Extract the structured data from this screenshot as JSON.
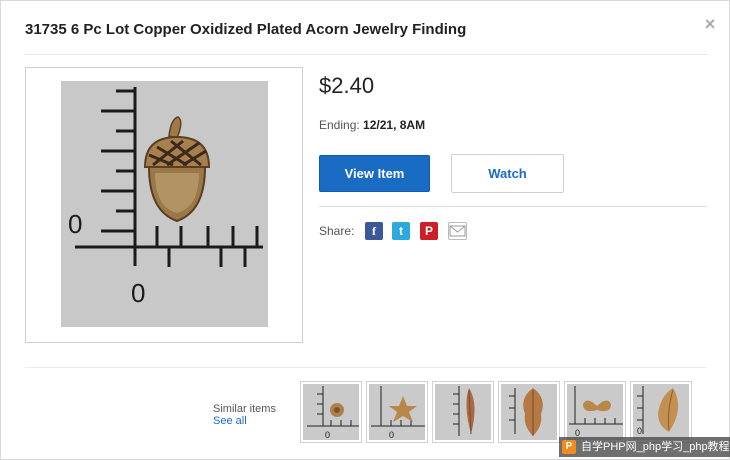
{
  "modal": {
    "title": "31735 6 Pc Lot Copper Oxidized Plated Acorn Jewelry Finding",
    "close_glyph": "×"
  },
  "product": {
    "image_label": "0",
    "price": "$2.40",
    "ending_label": "Ending:",
    "ending_value": "12/21, 8AM"
  },
  "actions": {
    "view_item_label": "View Item",
    "watch_label": "Watch"
  },
  "share": {
    "label": "Share:",
    "icons": [
      "facebook-icon",
      "twitter-icon",
      "pinterest-icon",
      "email-icon"
    ],
    "facebook_glyph": "f",
    "twitter_glyph": "t",
    "pinterest_glyph": "P"
  },
  "similar": {
    "label": "Similar items",
    "see_all": "See all",
    "thumb_label": "0",
    "items": [
      "flower-finding",
      "star-flower-finding",
      "leaf-finding",
      "oak-leaf-finding",
      "butterfly-finding",
      "leaf-finding-2"
    ]
  },
  "watermark": {
    "logo": "P",
    "text": "自学PHP网_php学习_php教程"
  },
  "colors": {
    "primary_button": "#1a6bc4",
    "link": "#1a6bc4",
    "facebook": "#3b5998",
    "twitter": "#2fa8de",
    "pinterest": "#cb2027",
    "metal": "#a27a4a"
  }
}
